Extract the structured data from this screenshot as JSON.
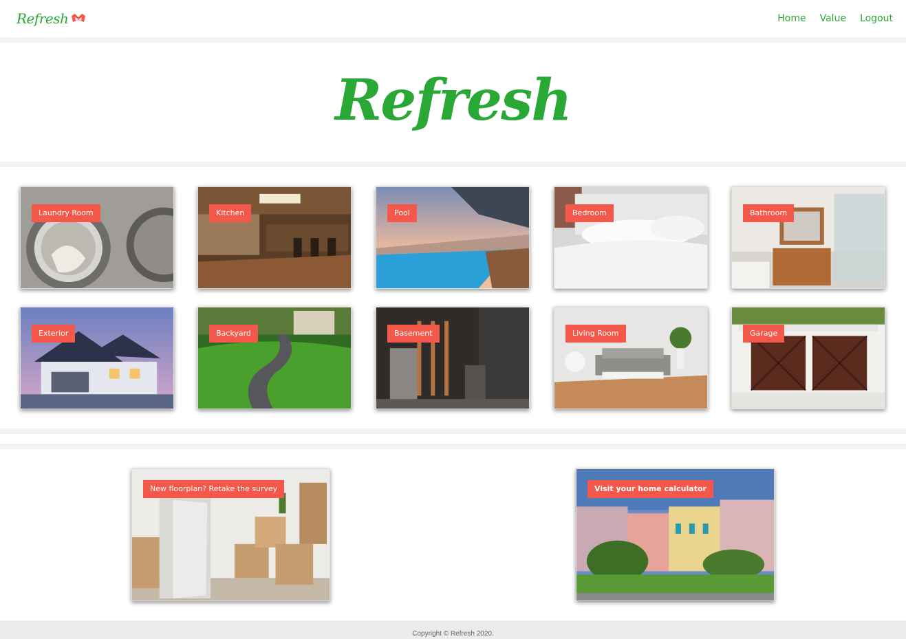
{
  "navbar": {
    "brand": "Refresh",
    "links": [
      "Home",
      "Value",
      "Logout"
    ]
  },
  "hero": {
    "title": "Refresh"
  },
  "rooms": [
    {
      "label": "Laundry Room",
      "icon": "washing-machine-image"
    },
    {
      "label": "Kitchen",
      "icon": "kitchen-image"
    },
    {
      "label": "Pool",
      "icon": "pool-image"
    },
    {
      "label": "Bedroom",
      "icon": "bedroom-image"
    },
    {
      "label": "Bathroom",
      "icon": "bathroom-image"
    },
    {
      "label": "Exterior",
      "icon": "house-exterior-image"
    },
    {
      "label": "Backyard",
      "icon": "backyard-image"
    },
    {
      "label": "Basement",
      "icon": "basement-image"
    },
    {
      "label": "Living Room",
      "icon": "living-room-image"
    },
    {
      "label": "Garage",
      "icon": "garage-image"
    }
  ],
  "actions": {
    "survey": "New floorplan? Retake the survey",
    "calculator": "Visit your home calculator"
  },
  "footer": {
    "copyright": "Copyright © Refresh 2020."
  },
  "colors": {
    "brand_green": "#2aa836",
    "tag_red": "#f4584b"
  }
}
